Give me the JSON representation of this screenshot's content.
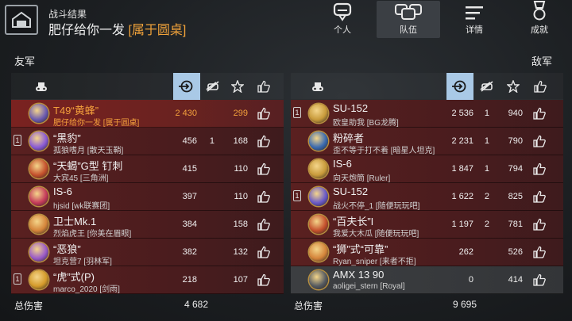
{
  "header": {
    "subtitle": "战斗结果",
    "title": "肥仔给你一发",
    "clan": "[属于圆桌]",
    "tabs": [
      {
        "label": "个人",
        "icon": "soldier-icon",
        "active": false
      },
      {
        "label": "队伍",
        "icon": "team-icon",
        "active": true
      },
      {
        "label": "详情",
        "icon": "details-icon",
        "active": false
      },
      {
        "label": "成就",
        "icon": "medal-icon",
        "active": false
      }
    ]
  },
  "allies": {
    "label": "友军",
    "total_label": "总伤害",
    "total_damage": "4 682",
    "rows": [
      {
        "name": "T49“黄蜂”",
        "player": "肥仔给你一发 [属于圆桌]",
        "damage": "2 430",
        "kills": "",
        "exp": "299",
        "badge": "",
        "style": "hl",
        "icon": "tank-icon",
        "tint": "#6b5ab0"
      },
      {
        "name": "“黑豹”",
        "player": "孤狼嗜月 [散天玉鞘]",
        "damage": "456",
        "kills": "1",
        "exp": "168",
        "badge": "1",
        "style": "red",
        "icon": "tank-icon",
        "tint": "#8a5ad6"
      },
      {
        "name": "“天蝎”G型 钉刺",
        "player": "大宾45 [三角洲]",
        "damage": "415",
        "kills": "",
        "exp": "110",
        "badge": "",
        "style": "red",
        "icon": "tank-icon",
        "tint": "#c4502c"
      },
      {
        "name": "IS-6",
        "player": "hjsid [wk联赛团]",
        "damage": "397",
        "kills": "",
        "exp": "110",
        "badge": "",
        "style": "red",
        "icon": "tank-icon",
        "tint": "#c43a5a"
      },
      {
        "name": "卫士Mk.1",
        "player": "烈焰虎王 [你美在眉眼]",
        "damage": "384",
        "kills": "",
        "exp": "158",
        "badge": "",
        "style": "red",
        "icon": "tank-icon",
        "tint": "#d4843a"
      },
      {
        "name": "“恶狼”",
        "player": "坦克营7 [羽林军]",
        "damage": "382",
        "kills": "",
        "exp": "132",
        "badge": "",
        "style": "red",
        "icon": "tank-icon",
        "tint": "#9a5ac8"
      },
      {
        "name": "“虎”式(P)",
        "player": "marco_2020 [剑雨]",
        "damage": "218",
        "kills": "",
        "exp": "107",
        "badge": "1",
        "style": "red",
        "icon": "tank-icon",
        "tint": "#d49a2a"
      }
    ]
  },
  "enemies": {
    "label": "敌军",
    "total_label": "总伤害",
    "total_damage": "9 695",
    "rows": [
      {
        "name": "SU-152",
        "player": "欧皇助我 [BG龙腾]",
        "damage": "2 536",
        "kills": "1",
        "exp": "940",
        "badge": "1",
        "style": "red",
        "icon": "tank-icon",
        "tint": "#c89a3a"
      },
      {
        "name": "粉碎者",
        "player": "歪不等于打不着 [暗星人坦克]",
        "damage": "2 231",
        "kills": "1",
        "exp": "790",
        "badge": "",
        "style": "red",
        "icon": "tank-icon",
        "tint": "#3a6ab0"
      },
      {
        "name": "IS-6",
        "player": "向天炮筒 [Ruler]",
        "damage": "1 847",
        "kills": "1",
        "exp": "794",
        "badge": "",
        "style": "red",
        "icon": "tank-icon",
        "tint": "#c89a3a"
      },
      {
        "name": "SU-152",
        "player": "战火不停_1 [随便玩玩吧]",
        "damage": "1 622",
        "kills": "2",
        "exp": "825",
        "badge": "1",
        "style": "red",
        "icon": "tank-icon",
        "tint": "#6a5ac8"
      },
      {
        "name": "“百夫长”I",
        "player": "我爱大木瓜 [随便玩玩吧]",
        "damage": "1 197",
        "kills": "2",
        "exp": "781",
        "badge": "",
        "style": "red",
        "icon": "tank-icon",
        "tint": "#c4502c"
      },
      {
        "name": "“狮”式“可靠”",
        "player": "Ryan_sniper [来者不拒]",
        "damage": "262",
        "kills": "",
        "exp": "526",
        "badge": "",
        "style": "red",
        "icon": "tank-icon",
        "tint": "#d4843a"
      },
      {
        "name": "AMX 13 90",
        "player": "aoligei_stern [Royal]",
        "damage": "0",
        "kills": "",
        "exp": "414",
        "badge": "",
        "style": "gray",
        "icon": "tank-icon",
        "tint": "#555a60"
      }
    ]
  },
  "columns": [
    {
      "icon": "tank-icon"
    },
    {
      "icon": "damage-icon",
      "selected": true
    },
    {
      "icon": "kills-icon"
    },
    {
      "icon": "star-icon"
    },
    {
      "icon": "like-icon"
    }
  ]
}
